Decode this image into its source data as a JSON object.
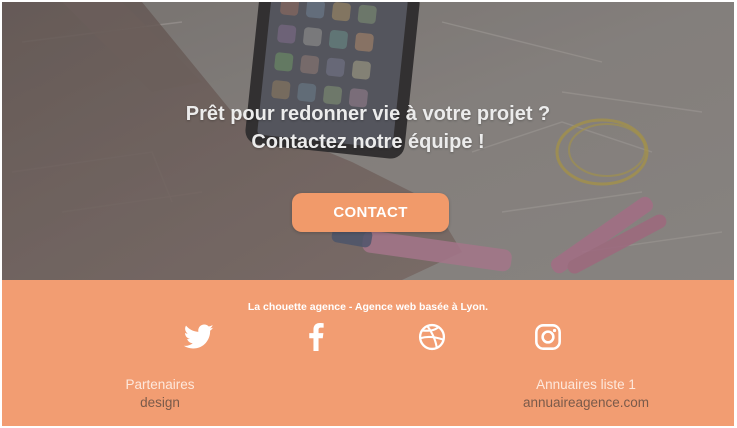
{
  "colors": {
    "accent": "#f19a6a",
    "footer_bg": "#f29d72",
    "hero_text": "#ececec"
  },
  "hero": {
    "title_line1": "Prêt pour redonner vie à votre projet ?",
    "title_line2": "Contactez notre équipe !",
    "cta_label": "CONTACT"
  },
  "footer": {
    "tagline": "La chouette agence - Agence web basée à Lyon.",
    "social": [
      {
        "icon": "twitter-icon"
      },
      {
        "icon": "facebook-icon"
      },
      {
        "icon": "dribbble-icon"
      },
      {
        "icon": "instagram-icon"
      }
    ],
    "left": {
      "heading": "Partenaires",
      "link": "design"
    },
    "right": {
      "heading": "Annuaires liste 1",
      "link": "annuaireagence.com"
    }
  }
}
